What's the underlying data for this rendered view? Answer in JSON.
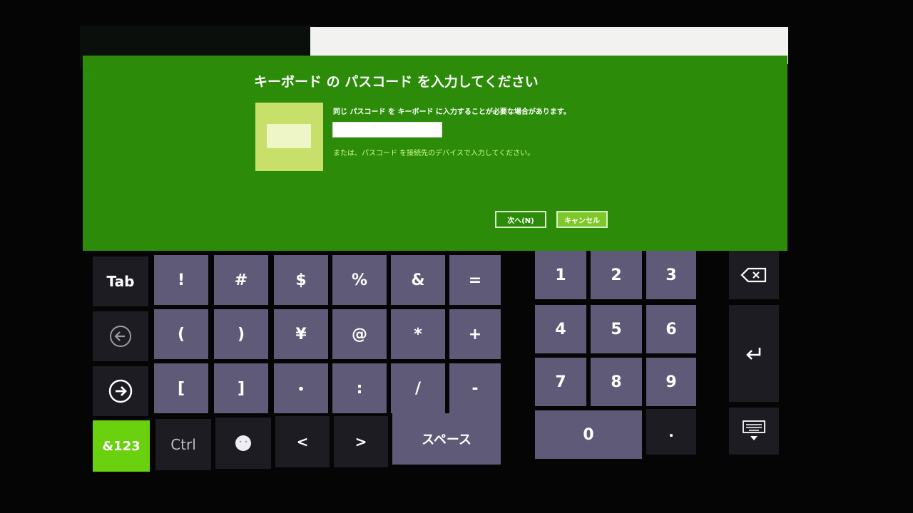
{
  "dialog": {
    "title": "キーボード の パスコード を入力してください",
    "info": "同じ パスコード を キーボード に入力することが必要な場合があります。",
    "alt": "または、パスコード を接続先のデバイスで入力してください。",
    "next_label": "次へ(N)",
    "cancel_label": "キャンセル"
  },
  "keyboard": {
    "tab": "Tab",
    "symbols": {
      "row1": [
        "!",
        "#",
        "$",
        "%",
        "&",
        "="
      ],
      "row2": [
        "(",
        ")",
        "¥",
        "@",
        "*",
        "+"
      ],
      "row3": [
        "[",
        "]",
        "・",
        ":",
        "/",
        "-"
      ]
    },
    "mode_key": "&123",
    "ctrl": "Ctrl",
    "less": "<",
    "greater": ">",
    "space": "スペース",
    "numpad": [
      "1",
      "2",
      "3",
      "4",
      "5",
      "6",
      "7",
      "8",
      "9"
    ],
    "zero": "0",
    "dot": "."
  },
  "colors": {
    "dialog_bg": "#2c8c0a",
    "accent_green": "#6ad10e",
    "key_light": "#5e5a78",
    "key_dark": "#1c1c22"
  }
}
